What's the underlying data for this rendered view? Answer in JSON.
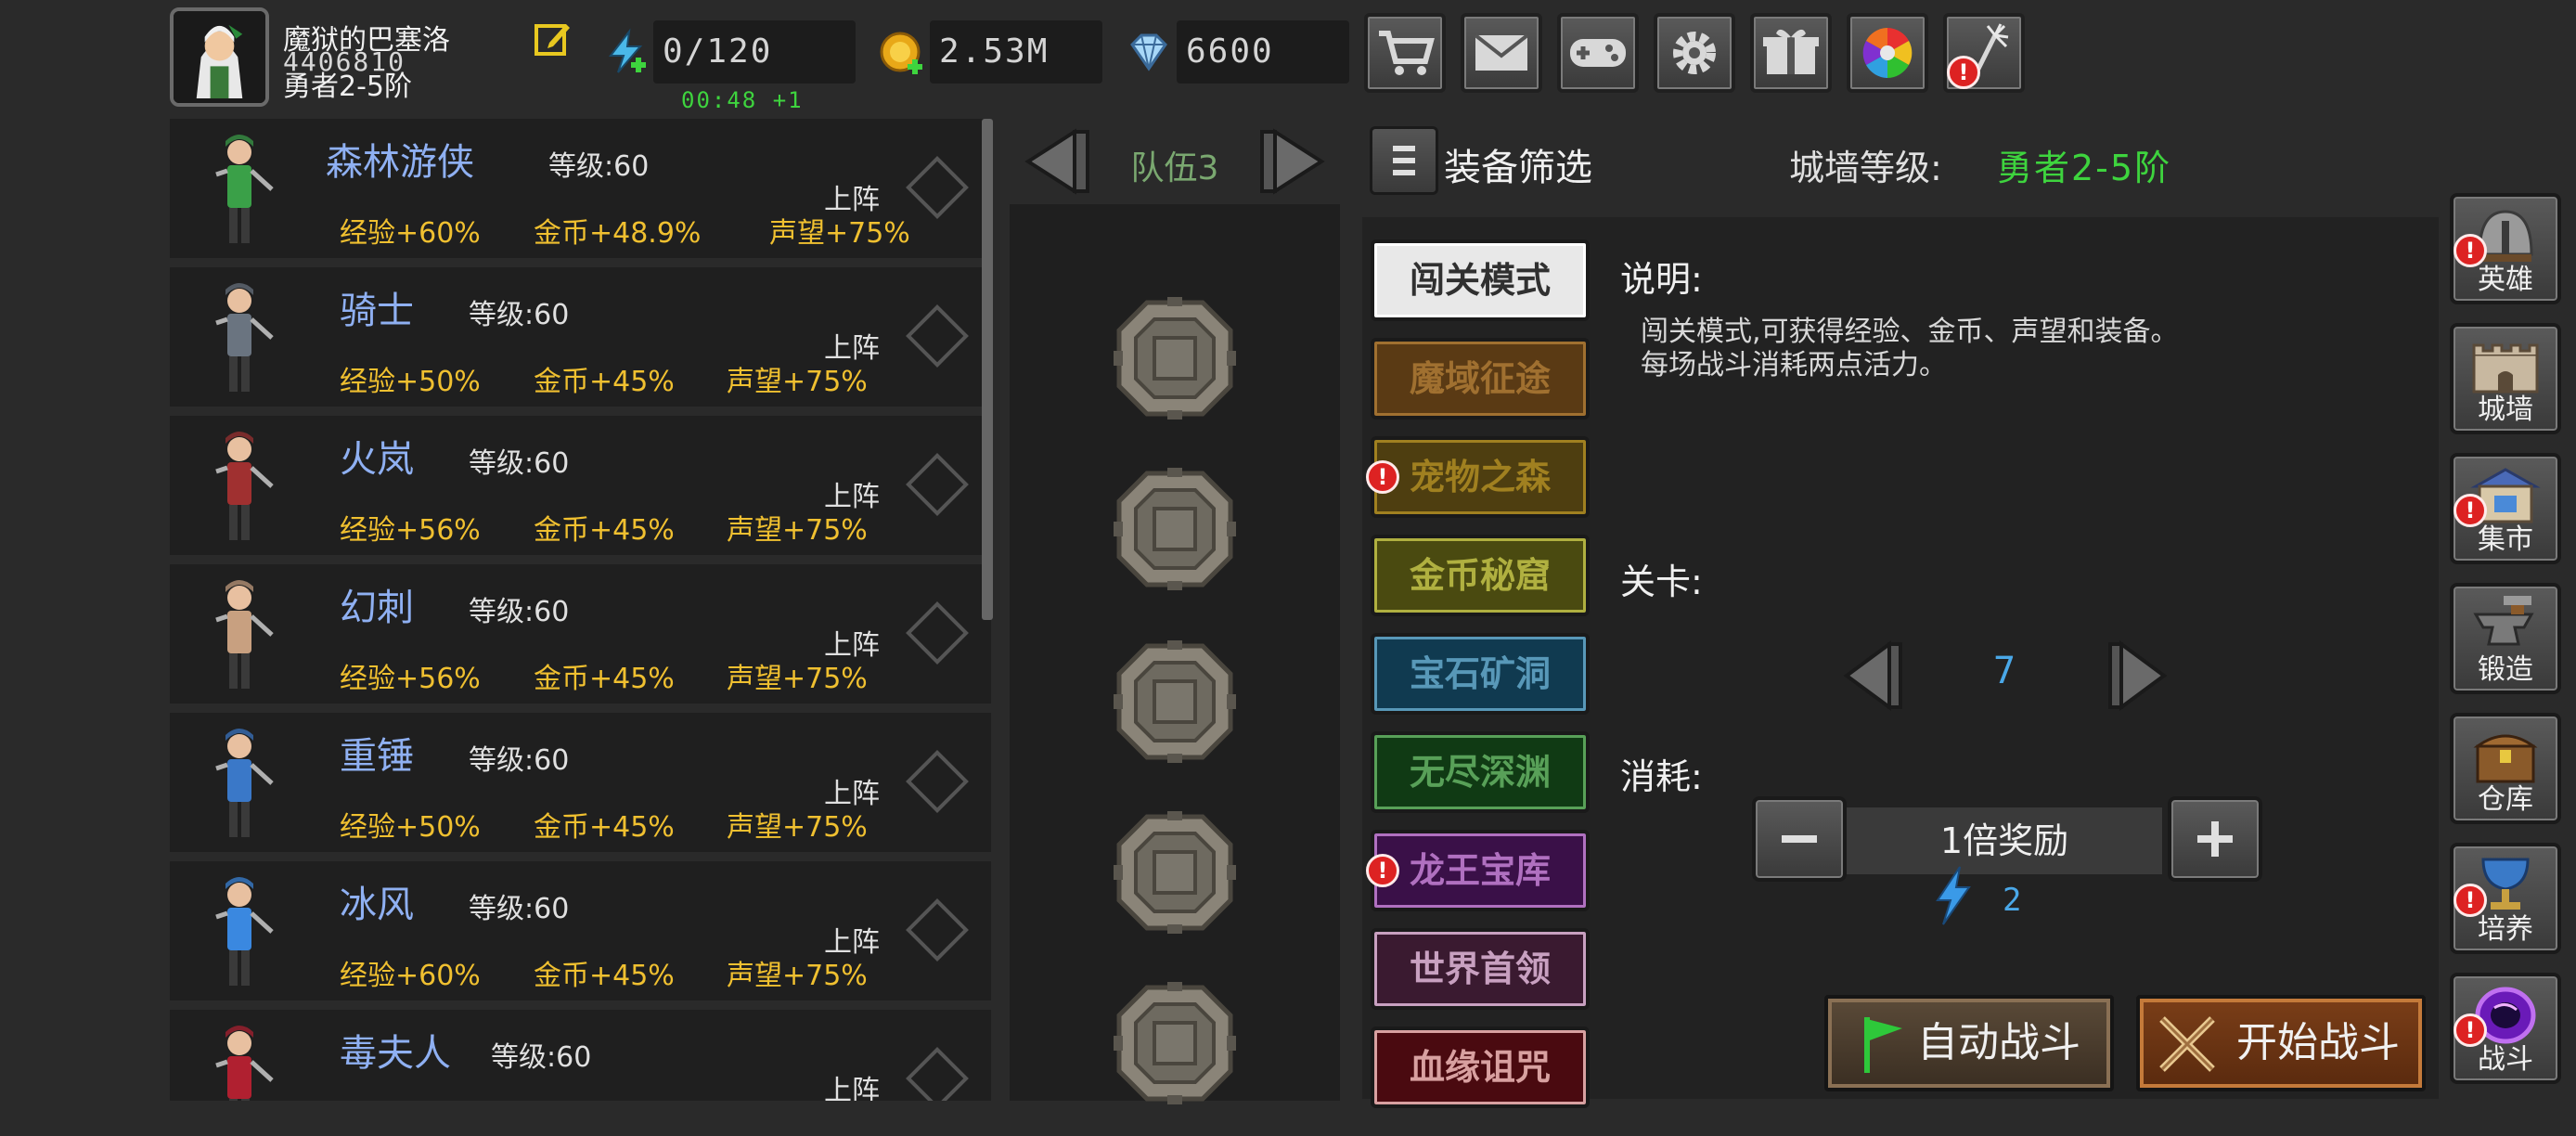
{
  "player": {
    "name": "魔狱的巴塞洛",
    "id": "4406810",
    "rank": "勇者2-5阶"
  },
  "resources": {
    "energy": "0/120",
    "energy_timer": "00:48",
    "energy_regen": "+1",
    "gold": "2.53M",
    "gems": "6600"
  },
  "top_buttons": [
    {
      "icon": "cart-icon"
    },
    {
      "icon": "mail-icon"
    },
    {
      "icon": "gamepad-icon"
    },
    {
      "icon": "gear-icon"
    },
    {
      "icon": "gift-icon"
    },
    {
      "icon": "color-wheel-icon"
    },
    {
      "icon": "firework-icon"
    }
  ],
  "heroes": [
    {
      "name": "森林游侠",
      "level": "等级:60",
      "exp": "经验+60%",
      "gold": "金币+48.9%",
      "fame": "声望+75%",
      "action": "上阵",
      "color": "#3aa048"
    },
    {
      "name": "骑士",
      "level": "等级:60",
      "exp": "经验+50%",
      "gold": "金币+45%",
      "fame": "声望+75%",
      "action": "上阵",
      "color": "#6a7480"
    },
    {
      "name": "火岚",
      "level": "等级:60",
      "exp": "经验+56%",
      "gold": "金币+45%",
      "fame": "声望+75%",
      "action": "上阵",
      "color": "#a03030"
    },
    {
      "name": "幻刺",
      "level": "等级:60",
      "exp": "经验+56%",
      "gold": "金币+45%",
      "fame": "声望+75%",
      "action": "上阵",
      "color": "#c8a080"
    },
    {
      "name": "重锤",
      "level": "等级:60",
      "exp": "经验+50%",
      "gold": "金币+45%",
      "fame": "声望+75%",
      "action": "上阵",
      "color": "#3a78c8"
    },
    {
      "name": "冰风",
      "level": "等级:60",
      "exp": "经验+60%",
      "gold": "金币+45%",
      "fame": "声望+75%",
      "action": "上阵",
      "color": "#3a88e0"
    },
    {
      "name": "毒夫人",
      "level": "等级:60",
      "exp": "",
      "gold": "",
      "fame": "",
      "action": "上阵",
      "color": "#b02030"
    }
  ],
  "team": {
    "label": "队伍3"
  },
  "filter_label": "装备筛选",
  "wall": {
    "label": "城墙等级:",
    "value": "勇者2-5阶"
  },
  "modes": [
    {
      "label": "闯关模式",
      "bg": "#e8e8e8",
      "fg": "#303030",
      "alert": false
    },
    {
      "label": "魔域征途",
      "bg": "#5a3a14",
      "fg": "#a07030",
      "alert": false
    },
    {
      "label": "宠物之森",
      "bg": "#4e3e10",
      "fg": "#a08020",
      "alert": true
    },
    {
      "label": "金币秘窟",
      "bg": "#4a4a10",
      "fg": "#b0b040",
      "alert": false
    },
    {
      "label": "宝石矿洞",
      "bg": "#103a50",
      "fg": "#5898b8",
      "alert": false
    },
    {
      "label": "无尽深渊",
      "bg": "#103a14",
      "fg": "#58a058",
      "alert": false
    },
    {
      "label": "龙王宝库",
      "bg": "#3a1048",
      "fg": "#b070c0",
      "alert": true
    },
    {
      "label": "世界首领",
      "bg": "#3a1a30",
      "fg": "#c8a0c0",
      "alert": false
    },
    {
      "label": "血缘诅咒",
      "bg": "#4a0a10",
      "fg": "#d8a0a0",
      "alert": false
    }
  ],
  "description": {
    "heading": "说明:",
    "line1": "闯关模式,可获得经验、金币、声望和装备。",
    "line2": "每场战斗消耗两点活力。"
  },
  "stage": {
    "label": "关卡:",
    "value": "7"
  },
  "cost": {
    "label": "消耗:",
    "multiplier": "1倍奖励",
    "energy": "2"
  },
  "buttons": {
    "auto_battle": "自动战斗",
    "start_battle": "开始战斗"
  },
  "side_nav": [
    {
      "label": "英雄",
      "icon": "helmet-icon",
      "alert": true
    },
    {
      "label": "城墙",
      "icon": "castle-icon",
      "alert": false
    },
    {
      "label": "集市",
      "icon": "market-icon",
      "alert": true
    },
    {
      "label": "锻造",
      "icon": "anvil-icon",
      "alert": false
    },
    {
      "label": "仓库",
      "icon": "chest-icon",
      "alert": false
    },
    {
      "label": "培养",
      "icon": "chalice-icon",
      "alert": true
    },
    {
      "label": "战斗",
      "icon": "portal-icon",
      "alert": true
    }
  ]
}
